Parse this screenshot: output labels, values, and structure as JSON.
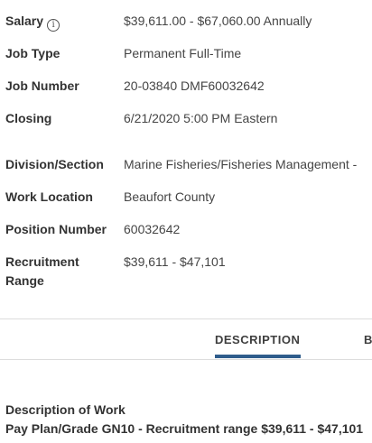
{
  "details": {
    "salary": {
      "label": "Salary",
      "value": "$39,611.00 - $67,060.00 Annually"
    },
    "job_type": {
      "label": "Job Type",
      "value": "Permanent Full-Time"
    },
    "job_number": {
      "label": "Job Number",
      "value": "20-03840 DMF60032642"
    },
    "closing": {
      "label": "Closing",
      "value": "6/21/2020 5:00 PM Eastern"
    },
    "division": {
      "label": "Division/Section",
      "value": "Marine Fisheries/Fisheries Management - "
    },
    "work_location": {
      "label": "Work Location",
      "value": "Beaufort County"
    },
    "position_number": {
      "label": "Position Number",
      "value": "60032642"
    },
    "recruitment_range": {
      "label": "Recruitment Range",
      "value": "$39,611 - $47,101"
    }
  },
  "tabs": {
    "description": "DESCRIPTION",
    "next_partial": "B"
  },
  "description": {
    "heading": "Description of Work",
    "pay_line": "Pay Plan/Grade GN10 - Recruitment range $39,611 - $47,101"
  },
  "colors": {
    "active_tab_underline": "#2f5d8c",
    "label_text": "#333333",
    "value_text": "#454545"
  }
}
